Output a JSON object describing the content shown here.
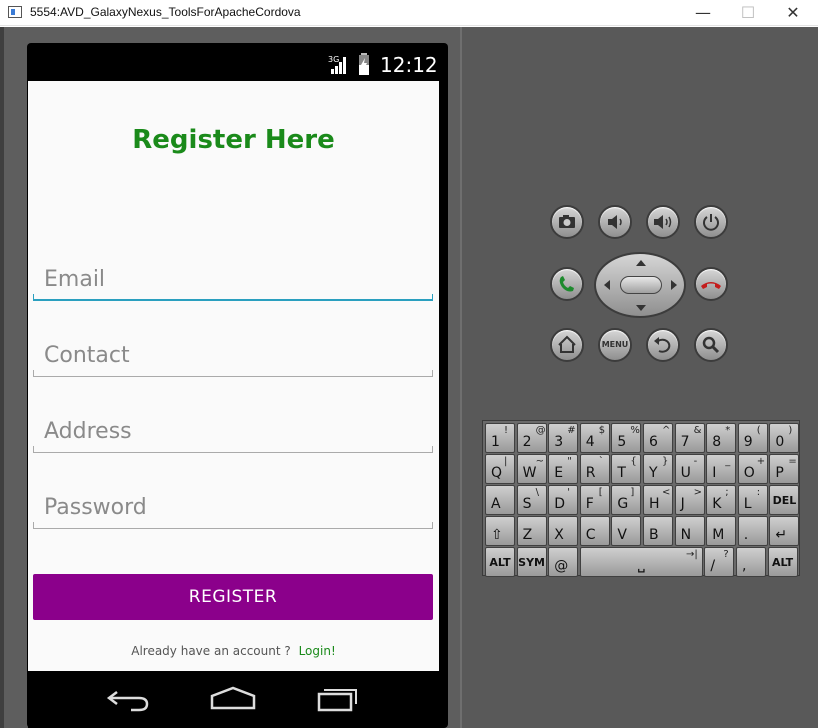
{
  "window": {
    "title": "5554:AVD_GalaxyNexus_ToolsForApacheCordova",
    "minimize_glyph": "—",
    "maximize_glyph": "☐",
    "close_glyph": "✕"
  },
  "status_bar": {
    "network": "3G",
    "time": "12:12"
  },
  "app": {
    "title": "Register Here",
    "fields": [
      {
        "placeholder": "Email",
        "focused": true
      },
      {
        "placeholder": "Contact",
        "focused": false
      },
      {
        "placeholder": "Address",
        "focused": false
      },
      {
        "placeholder": "Password",
        "focused": false
      }
    ],
    "register_label": "REGISTER",
    "login_prompt": "Already have an account ?",
    "login_link": "Login!"
  },
  "nav_bar": [
    "back-icon",
    "home-icon",
    "recents-icon"
  ],
  "controls": {
    "menu_label": "MENU",
    "hardware_buttons": [
      "camera-icon",
      "volume-down-icon",
      "volume-up-icon",
      "power-icon",
      "call-icon",
      "end-call-icon",
      "home-icon",
      "menu",
      "back-icon",
      "search-icon"
    ]
  },
  "keyboard": {
    "row1": [
      [
        "1",
        "!"
      ],
      [
        "2",
        "@"
      ],
      [
        "3",
        "#"
      ],
      [
        "4",
        "$"
      ],
      [
        "5",
        "%"
      ],
      [
        "6",
        "^"
      ],
      [
        "7",
        "&"
      ],
      [
        "8",
        "*"
      ],
      [
        "9",
        "("
      ],
      [
        "0",
        ")"
      ]
    ],
    "row2": [
      [
        "Q",
        "|"
      ],
      [
        "W",
        "~"
      ],
      [
        "E",
        "\""
      ],
      [
        "R",
        "`"
      ],
      [
        "T",
        "{"
      ],
      [
        "Y",
        "}"
      ],
      [
        "U",
        "-"
      ],
      [
        "I",
        "_"
      ],
      [
        "O",
        "+"
      ],
      [
        "P",
        "="
      ]
    ],
    "row3": [
      [
        "A",
        ""
      ],
      [
        "S",
        "\\"
      ],
      [
        "D",
        "'"
      ],
      [
        "F",
        "["
      ],
      [
        "G",
        "]"
      ],
      [
        "H",
        "<"
      ],
      [
        "J",
        ">"
      ],
      [
        "K",
        ";"
      ],
      [
        "L",
        ":"
      ],
      [
        "DEL",
        ""
      ]
    ],
    "row4": [
      [
        "⇧",
        ""
      ],
      [
        "Z",
        ""
      ],
      [
        "X",
        ""
      ],
      [
        "C",
        ""
      ],
      [
        "V",
        ""
      ],
      [
        "B",
        ""
      ],
      [
        "N",
        ""
      ],
      [
        "M",
        ""
      ],
      [
        ".",
        ""
      ],
      [
        "↵",
        ""
      ]
    ],
    "row5": [
      [
        "ALT",
        ""
      ],
      [
        "SYM",
        ""
      ],
      [
        "@",
        ""
      ],
      [
        "␣",
        "→|"
      ],
      [
        "/",
        "?"
      ],
      [
        ",",
        ""
      ],
      [
        "ALT",
        ""
      ]
    ]
  },
  "colors": {
    "title_green": "#1a8a1a",
    "register_purple": "#8b008b",
    "focus_underline": "#2a9fbf",
    "emulator_gray": "#595959"
  }
}
